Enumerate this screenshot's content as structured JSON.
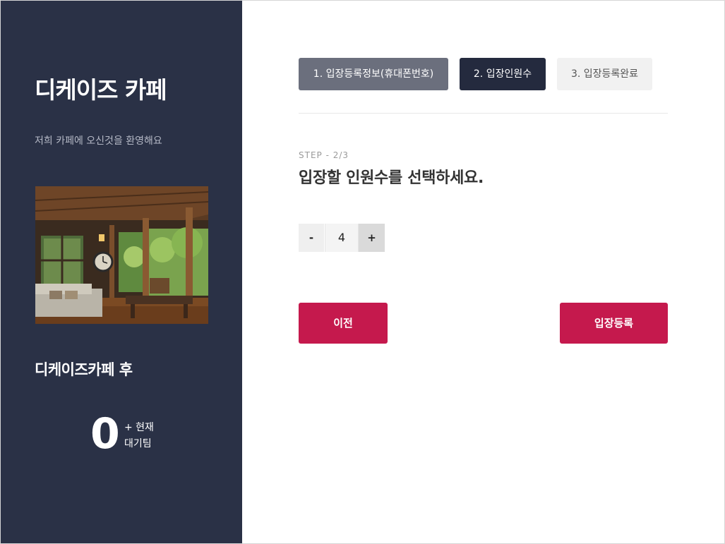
{
  "sidebar": {
    "brand_title": "디케이즈 카페",
    "brand_subtitle": "저희 카페에 오신것을 환영해요",
    "photo_description": "cafe-interior-photo",
    "queue_title": "디케이즈카페 후",
    "queue_count": "0",
    "queue_caption": "+ 현재\n대기팀"
  },
  "steps": {
    "tabs": [
      {
        "label": "1. 입장등록정보(휴대폰번호)",
        "state": "completed"
      },
      {
        "label": "2. 입장인원수",
        "state": "active"
      },
      {
        "label": "3. 입장등록완료",
        "state": "pending"
      }
    ]
  },
  "main": {
    "step_label": "STEP - 2/3",
    "heading": "입장할 인원수를 선택하세요.",
    "stepper": {
      "minus_label": "-",
      "value": "4",
      "plus_label": "+"
    },
    "prev_button": "이전",
    "submit_button": "입장등록"
  },
  "colors": {
    "sidebar_bg": "#2a3146",
    "active_tab": "#242a3e",
    "completed_tab": "#6b6f7d",
    "pending_tab": "#f1f1f1",
    "accent": "#c5194d"
  }
}
